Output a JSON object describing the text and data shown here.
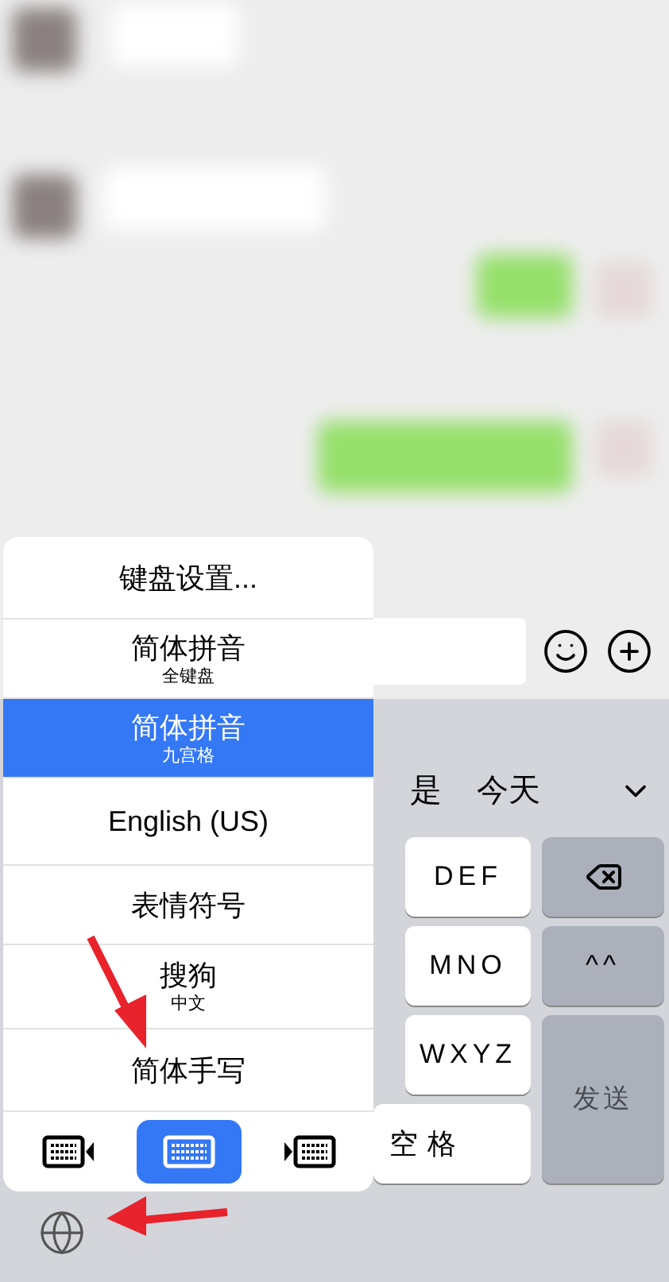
{
  "menu": {
    "items": [
      {
        "kind": "plain",
        "label": "键盘设置...",
        "selected": false
      },
      {
        "kind": "subtitled",
        "label": "简体拼音",
        "subtitle": "全键盘",
        "selected": false
      },
      {
        "kind": "subtitled",
        "label": "简体拼音",
        "subtitle": "九宫格",
        "selected": true
      },
      {
        "kind": "plain",
        "label": "English (US)",
        "selected": false
      },
      {
        "kind": "plain",
        "label": "表情符号",
        "selected": false
      },
      {
        "kind": "subtitled",
        "label": "搜狗",
        "subtitle": "中文",
        "selected": false
      },
      {
        "kind": "plain",
        "label": "简体手写",
        "selected": false
      }
    ],
    "layouts": [
      {
        "kind": "left",
        "selected": false
      },
      {
        "kind": "full",
        "selected": true
      },
      {
        "kind": "right",
        "selected": false
      }
    ]
  },
  "candidates": [
    "是",
    "今天"
  ],
  "keys": [
    {
      "kind": "letter",
      "label": "DEF"
    },
    {
      "kind": "delete"
    },
    {
      "kind": "letter",
      "label": "MNO"
    },
    {
      "kind": "letter",
      "label": "^^"
    },
    {
      "kind": "letter",
      "label": "WXYZ"
    },
    {
      "kind": "send",
      "label": "发送"
    },
    {
      "kind": "space",
      "label": "空格"
    }
  ]
}
